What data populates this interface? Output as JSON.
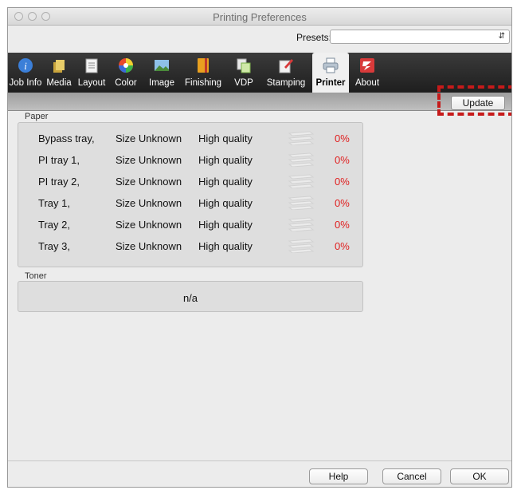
{
  "window": {
    "title": "Printing Preferences"
  },
  "presets": {
    "label": "Presets:",
    "value": ""
  },
  "toolbar": {
    "tabs": [
      {
        "label": "Job Info",
        "icon": "info-icon",
        "color": "#3b7fd8"
      },
      {
        "label": "Media",
        "icon": "media-icon",
        "color": "#d9b84a"
      },
      {
        "label": "Layout",
        "icon": "layout-icon",
        "color": "#e8e8e8"
      },
      {
        "label": "Color",
        "icon": "color-wheel-icon",
        "color": "#e84a2a"
      },
      {
        "label": "Image",
        "icon": "image-icon",
        "color": "#5a9a4a"
      },
      {
        "label": "Finishing",
        "icon": "finishing-icon",
        "color": "#e8a020"
      },
      {
        "label": "VDP",
        "icon": "vdp-icon",
        "color": "#7ab04a"
      },
      {
        "label": "Stamping",
        "icon": "stamping-icon",
        "color": "#d83a3a"
      },
      {
        "label": "Printer",
        "icon": "printer-icon",
        "color": "#9aa6b4"
      },
      {
        "label": "About",
        "icon": "about-icon",
        "color": "#d83a3a"
      }
    ],
    "active": "Printer"
  },
  "update_button": "Update",
  "paper": {
    "label": "Paper",
    "rows": [
      {
        "tray": "Bypass tray,",
        "size": "Size Unknown",
        "quality": "High quality",
        "percent": "0%"
      },
      {
        "tray": "PI tray 1,",
        "size": "Size Unknown",
        "quality": "High quality",
        "percent": "0%"
      },
      {
        "tray": "PI tray 2,",
        "size": "Size Unknown",
        "quality": "High quality",
        "percent": "0%"
      },
      {
        "tray": "Tray 1,",
        "size": "Size Unknown",
        "quality": "High quality",
        "percent": "0%"
      },
      {
        "tray": "Tray 2,",
        "size": "Size Unknown",
        "quality": "High quality",
        "percent": "0%"
      },
      {
        "tray": "Tray 3,",
        "size": "Size Unknown",
        "quality": "High quality",
        "percent": "0%"
      }
    ]
  },
  "toner": {
    "label": "Toner",
    "value": "n/a"
  },
  "buttons": {
    "help": "Help",
    "cancel": "Cancel",
    "ok": "OK"
  },
  "colors": {
    "highlight": "#c61a1a",
    "percent": "#e02020",
    "toolbar": "#2a2a2a"
  }
}
